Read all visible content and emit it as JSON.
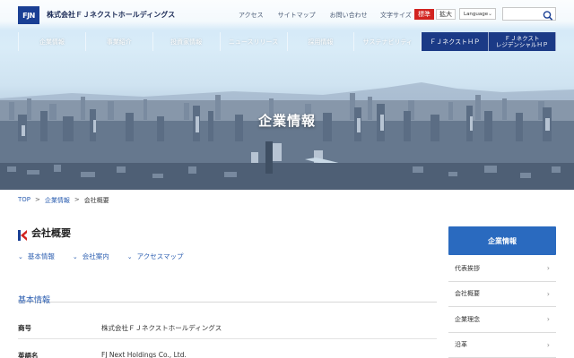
{
  "header": {
    "logo_mark": "FJN",
    "company_name": "株式会社ＦＪネクストホールディングス",
    "utility_links": [
      "アクセス",
      "サイトマップ",
      "お問い合わせ"
    ],
    "font_size_label": "文字サイズ",
    "font_size_standard": "標準",
    "font_size_large": "拡大",
    "language_select": "Language",
    "search_placeholder": ""
  },
  "nav": {
    "items": [
      {
        "label": "企業情報"
      },
      {
        "label": "事業紹介"
      },
      {
        "label": "投資家情報"
      },
      {
        "label": "ニュースリリース"
      },
      {
        "label": "採用情報"
      },
      {
        "label": "サステナビリティ"
      },
      {
        "label": "ＦＪネクストＨＰ"
      },
      {
        "label": "ＦＪネクスト\nレジデンシャルＨＰ"
      }
    ]
  },
  "banner": {
    "title": "企業情報"
  },
  "breadcrumb": {
    "top": "TOP",
    "parent": "企業情報",
    "current": "会社概要",
    "separator": ">"
  },
  "main": {
    "title": "会社概要",
    "anchors": [
      "基本情報",
      "会社案内",
      "アクセスマップ"
    ],
    "subsection_title": "基本情報",
    "rows": [
      {
        "key": "商号",
        "value": "株式会社ＦＪネクストホールディングス"
      },
      {
        "key": "英語名",
        "value": "FJ Next Holdings Co., Ltd."
      }
    ]
  },
  "side_menu": {
    "heading": "企業情報",
    "items": [
      "代表挨拶",
      "会社概要",
      "企業理念",
      "沿革"
    ]
  },
  "colors": {
    "brand_blue": "#1a3f94",
    "accent_blue": "#2a6abf",
    "link_blue": "#2d5fb1",
    "active_red": "#d2231f"
  }
}
